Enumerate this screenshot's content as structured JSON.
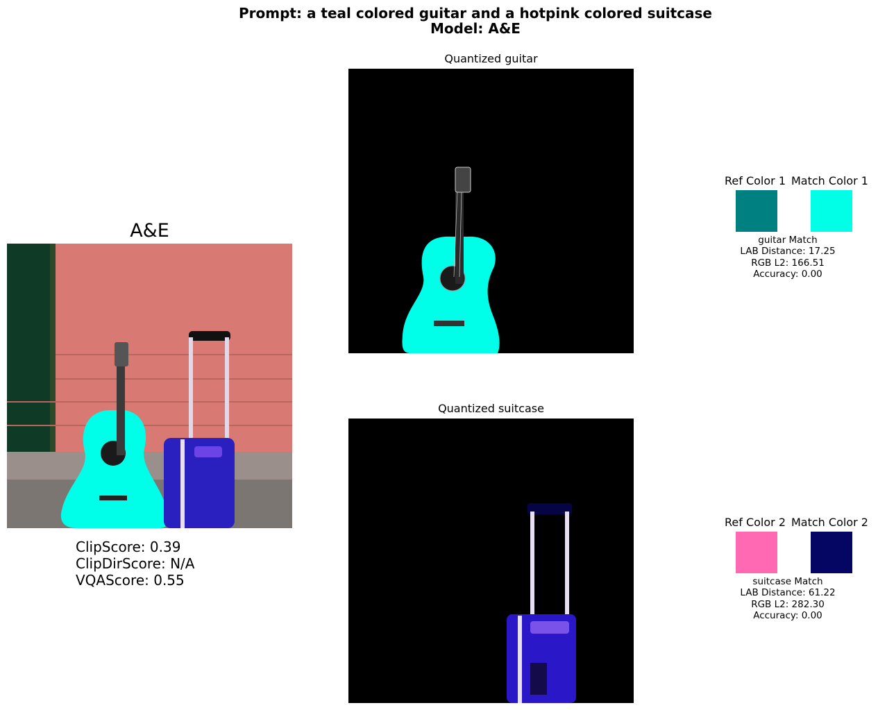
{
  "figure": {
    "suptitle_line1": "Prompt: a teal colored guitar and a hotpink colored suitcase",
    "suptitle_line2": "Model: A&E"
  },
  "left_panel": {
    "title": "A&E",
    "scores": [
      "ClipScore: 0.39",
      "ClipDirScore: N/A",
      "VQAScore: 0.55"
    ]
  },
  "quantized": [
    {
      "title": "Quantized guitar"
    },
    {
      "title": "Quantized suitcase"
    }
  ],
  "colors": [
    {
      "ref_label": "Ref Color 1",
      "match_label": "Match Color 1",
      "ref_hex": "#008080",
      "match_hex": "#00ffe6",
      "metrics": [
        "guitar Match",
        "LAB Distance: 17.25",
        "RGB L2: 166.51",
        "Accuracy: 0.00"
      ]
    },
    {
      "ref_label": "Ref Color 2",
      "match_label": "Match Color 2",
      "ref_hex": "#ff69b4",
      "match_hex": "#050564",
      "metrics": [
        "suitcase Match",
        "LAB Distance: 61.22",
        "RGB L2: 282.30",
        "Accuracy: 0.00"
      ]
    }
  ]
}
